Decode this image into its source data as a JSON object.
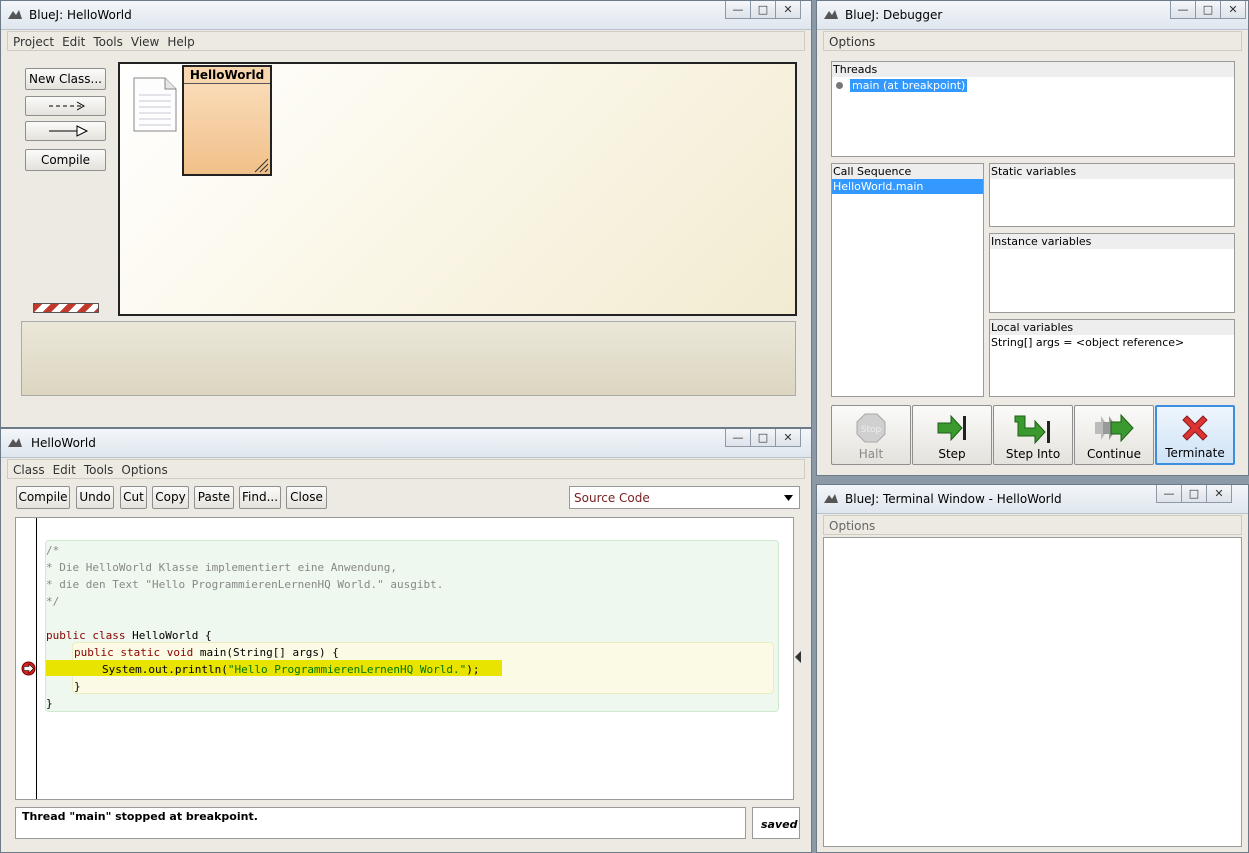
{
  "main_window": {
    "title": "BlueJ:  HelloWorld",
    "menu": [
      "Project",
      "Edit",
      "Tools",
      "View",
      "Help"
    ],
    "new_class_label": "New Class...",
    "compile_label": "Compile",
    "class_name": "HelloWorld"
  },
  "debugger": {
    "title": "BlueJ:  Debugger",
    "menu": [
      "Options"
    ],
    "threads_header": "Threads",
    "thread_item": "main (at breakpoint)",
    "call_sequence_header": "Call Sequence",
    "call_item": "HelloWorld.main",
    "static_header": "Static variables",
    "instance_header": "Instance variables",
    "local_header": "Local variables",
    "local_item": "String[] args = <object reference>",
    "buttons": [
      "Halt",
      "Step",
      "Step Into",
      "Continue",
      "Terminate"
    ],
    "stop_sign_text": "Stop"
  },
  "editor": {
    "title": "HelloWorld",
    "menu": [
      "Class",
      "Edit",
      "Tools",
      "Options"
    ],
    "toolbar": [
      "Compile",
      "Undo",
      "Cut",
      "Copy",
      "Paste",
      "Find...",
      "Close"
    ],
    "view_select": "Source Code",
    "code": {
      "c1": "/*",
      "c2": "* Die HelloWorld Klasse implementiert eine Anwendung,",
      "c3": "* die den Text \"Hello ProgrammierenLernenHQ World.\" ausgibt.",
      "c4": "*/",
      "l1_kw": "public class",
      "l1_rest": " HelloWorld {",
      "l2_kw": "public static void",
      "l2_rest": " main(String[] args) {",
      "l3_pre": "System.out.println(",
      "l3_str": "\"Hello ProgrammierenLernenHQ World.\"",
      "l3_post": ");",
      "l4": "}",
      "l5": "}"
    },
    "status": "Thread \"main\" stopped at breakpoint.",
    "saved": "saved"
  },
  "terminal": {
    "title": "BlueJ: Terminal Window - HelloWorld",
    "menu": [
      "Options"
    ]
  },
  "window_controls": {
    "minimize": "—",
    "maximize": "□",
    "close": "✕"
  },
  "colors": {
    "class_box": "#f6cfa3",
    "highlight_line": "#e8e400",
    "selection": "#3399ff",
    "keyword": "#8b0000",
    "string": "#007700",
    "comment": "#888888"
  }
}
